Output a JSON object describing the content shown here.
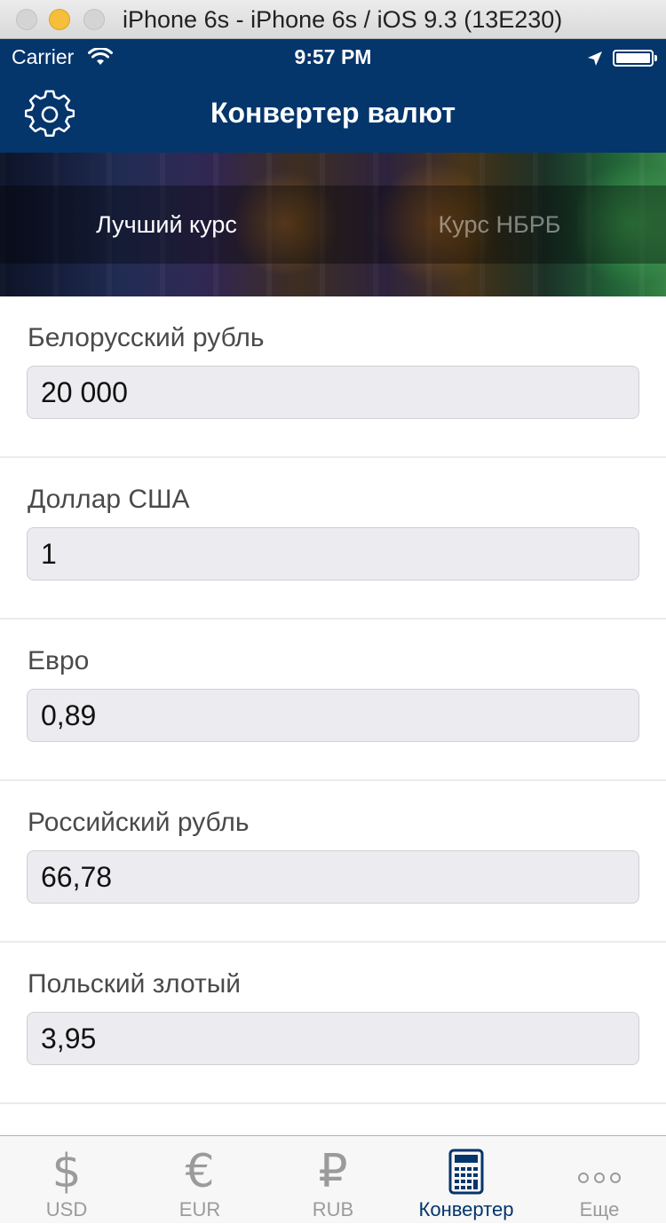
{
  "window": {
    "title": "iPhone 6s - iPhone 6s / iOS 9.3 (13E230)"
  },
  "status_bar": {
    "carrier": "Carrier",
    "time": "9:57 PM"
  },
  "nav": {
    "title": "Конвертер валют"
  },
  "segments": {
    "best_rate": "Лучший курс",
    "nbrb_rate": "Курс НБРБ",
    "selected": "best_rate"
  },
  "converter": {
    "rows": [
      {
        "label": "Белорусский рубль",
        "value": "20 000"
      },
      {
        "label": "Доллар США",
        "value": "1"
      },
      {
        "label": "Евро",
        "value": "0,89"
      },
      {
        "label": "Российский рубль",
        "value": "66,78"
      },
      {
        "label": "Польский злотый",
        "value": "3,95"
      }
    ]
  },
  "tabs": [
    {
      "label": "USD",
      "icon": "dollar-icon",
      "glyph": "$"
    },
    {
      "label": "EUR",
      "icon": "euro-icon",
      "glyph": "€"
    },
    {
      "label": "RUB",
      "icon": "ruble-icon",
      "glyph": "₽"
    },
    {
      "label": "Конвертер",
      "icon": "calculator-icon",
      "active": true
    },
    {
      "label": "Еще",
      "icon": "more-icon"
    }
  ],
  "colors": {
    "nav_background": "#04356b",
    "active_tab": "#04356b",
    "inactive_tab": "#9b9b9b",
    "field_background": "#ececf0"
  }
}
